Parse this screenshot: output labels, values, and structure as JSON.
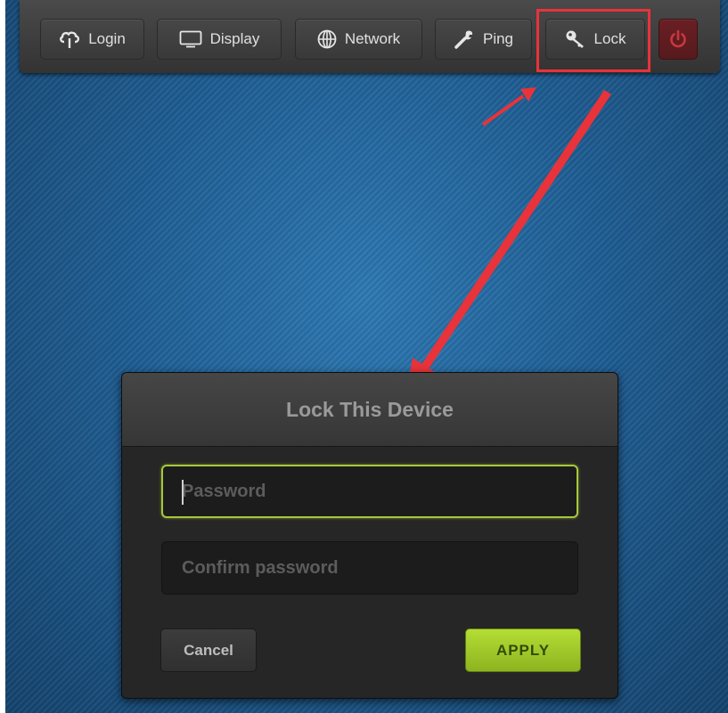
{
  "toolbar": {
    "login_label": "Login",
    "display_label": "Display",
    "network_label": "Network",
    "ping_label": "Ping",
    "lock_label": "Lock",
    "power_color": "#c9373e"
  },
  "dialog": {
    "title": "Lock This Device",
    "password_placeholder": "Password",
    "confirm_placeholder": "Confirm password",
    "cancel_label": "Cancel",
    "apply_label": "APPLY"
  },
  "annotation": {
    "highlight_color": "#e8333a",
    "highlight_target": "lock-button"
  }
}
